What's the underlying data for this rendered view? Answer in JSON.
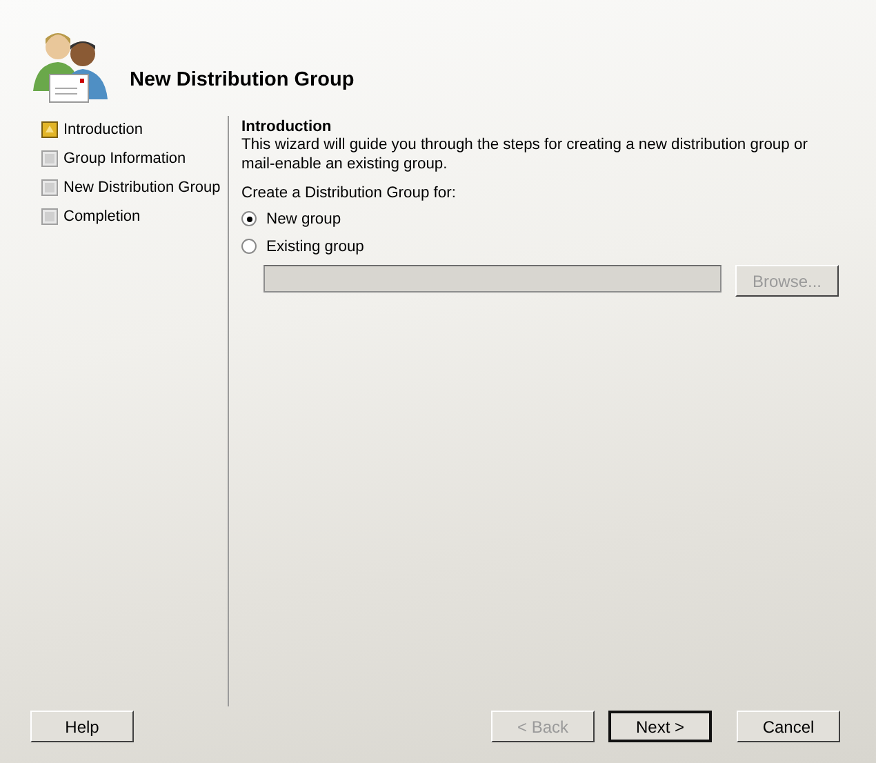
{
  "header": {
    "title": "New Distribution Group"
  },
  "steps": [
    {
      "label": "Introduction",
      "selected": true
    },
    {
      "label": "Group Information",
      "selected": false
    },
    {
      "label": "New Distribution Group",
      "selected": false
    },
    {
      "label": "Completion",
      "selected": false
    }
  ],
  "page": {
    "heading": "Introduction",
    "description": "This wizard will guide you through the steps for creating a new distribution group or mail-enable an existing group.",
    "prompt": "Create a Distribution Group for:",
    "options": [
      {
        "label": "New group",
        "selected": true
      },
      {
        "label": "Existing group",
        "selected": false
      }
    ],
    "group_field": {
      "disabled": true
    },
    "browse_button": {
      "label": "Browse...",
      "disabled": true
    }
  },
  "buttons": [
    {
      "label": "Help",
      "disabled": false,
      "default": false
    },
    {
      "label": "< Back",
      "disabled": true,
      "default": false
    },
    {
      "label": "Next >",
      "disabled": false,
      "default": true
    },
    {
      "label": "Cancel",
      "disabled": false,
      "default": false
    }
  ]
}
